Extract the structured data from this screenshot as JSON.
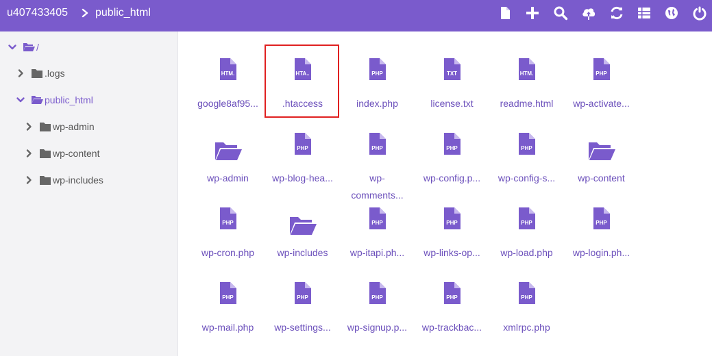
{
  "header": {
    "user": "u407433405",
    "current_dir": "public_html",
    "tools": [
      "new-file-icon",
      "new-item-icon",
      "search-icon",
      "upload-icon",
      "refresh-icon",
      "view-list-icon",
      "globe-icon",
      "power-icon"
    ]
  },
  "sidebar": {
    "root": "/",
    "items": [
      {
        "label": ".logs"
      },
      {
        "label": "public_html"
      },
      {
        "label": "wp-admin"
      },
      {
        "label": "wp-content"
      },
      {
        "label": "wp-includes"
      }
    ]
  },
  "files": [
    {
      "name": "google8af95...",
      "badge": "HTM.",
      "kind": "file"
    },
    {
      "name": ".htaccess",
      "badge": "HTA..",
      "kind": "file",
      "selected": true
    },
    {
      "name": "index.php",
      "badge": "PHP",
      "kind": "file"
    },
    {
      "name": "license.txt",
      "badge": "TXT",
      "kind": "file"
    },
    {
      "name": "readme.html",
      "badge": "HTM.",
      "kind": "file"
    },
    {
      "name": "wp-activate...",
      "badge": "PHP",
      "kind": "file"
    },
    {
      "name": "wp-admin",
      "kind": "folder"
    },
    {
      "name": "wp-blog-hea...",
      "badge": "PHP",
      "kind": "file"
    },
    {
      "name": "wp-comments...",
      "badge": "PHP",
      "kind": "file",
      "display": "wp-\ncomments..."
    },
    {
      "name": "wp-config.p...",
      "badge": "PHP",
      "kind": "file"
    },
    {
      "name": "wp-config-s...",
      "badge": "PHP",
      "kind": "file"
    },
    {
      "name": "wp-content",
      "kind": "folder"
    },
    {
      "name": "wp-cron.php",
      "badge": "PHP",
      "kind": "file"
    },
    {
      "name": "wp-includes",
      "kind": "folder"
    },
    {
      "name": "wp-itapi.ph...",
      "badge": "PHP",
      "kind": "file"
    },
    {
      "name": "wp-links-op...",
      "badge": "PHP",
      "kind": "file"
    },
    {
      "name": "wp-load.php",
      "badge": "PHP",
      "kind": "file"
    },
    {
      "name": "wp-login.ph...",
      "badge": "PHP",
      "kind": "file"
    },
    {
      "name": "wp-mail.php",
      "badge": "PHP",
      "kind": "file"
    },
    {
      "name": "wp-settings...",
      "badge": "PHP",
      "kind": "file"
    },
    {
      "name": "wp-signup.p...",
      "badge": "PHP",
      "kind": "file"
    },
    {
      "name": "wp-trackbac...",
      "badge": "PHP",
      "kind": "file"
    },
    {
      "name": "xmlrpc.php",
      "badge": "PHP",
      "kind": "file"
    }
  ],
  "colors": {
    "accent": "#7a5bcc",
    "icon": "#7a5bcc",
    "text_link": "#6b4fbb",
    "selection": "#e02020"
  }
}
